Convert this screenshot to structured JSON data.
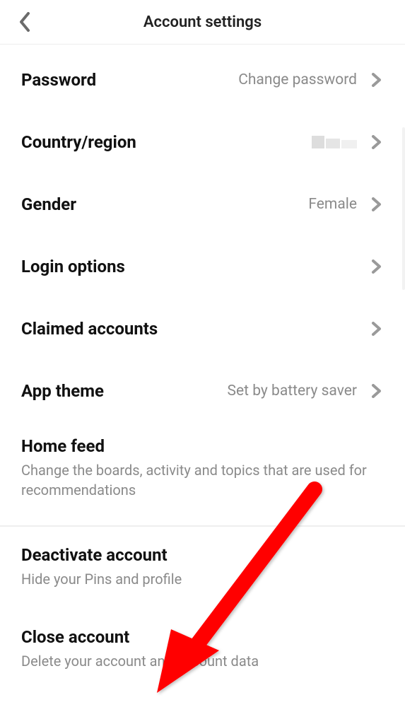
{
  "header": {
    "title": "Account settings"
  },
  "rows": {
    "password": {
      "label": "Password",
      "value": "Change password"
    },
    "country": {
      "label": "Country/region"
    },
    "gender": {
      "label": "Gender",
      "value": "Female"
    },
    "login": {
      "label": "Login options"
    },
    "claimed": {
      "label": "Claimed accounts"
    },
    "theme": {
      "label": "App theme",
      "value": "Set by battery saver"
    }
  },
  "homefeed": {
    "title": "Home feed",
    "subtitle": "Change the boards, activity and topics that are used for recommendations"
  },
  "deactivate": {
    "title": "Deactivate account",
    "subtitle": "Hide your Pins and profile"
  },
  "close": {
    "title": "Close account",
    "subtitle": "Delete your account and account data"
  }
}
